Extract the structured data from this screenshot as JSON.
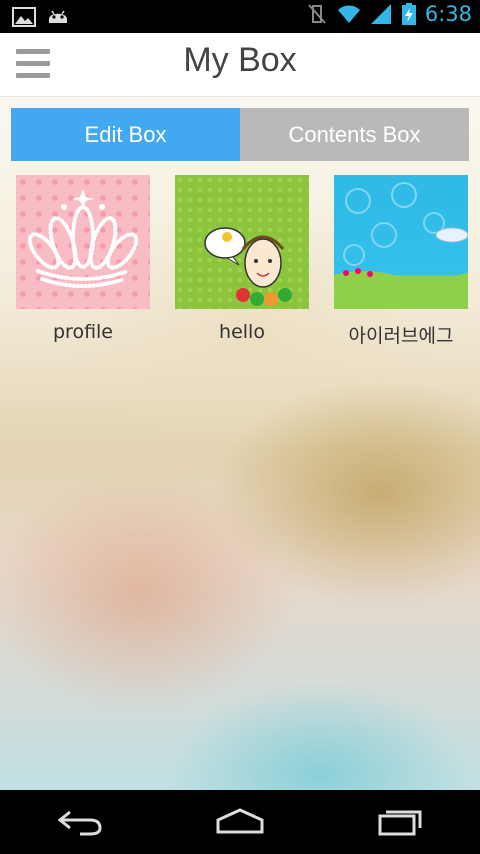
{
  "status_bar": {
    "time": "6:38",
    "left_icons": [
      "image-icon",
      "android-icon"
    ],
    "right_icons": [
      "vibrate-icon",
      "wifi-icon",
      "signal-icon",
      "battery-charging-icon"
    ],
    "accent_color": "#33b5e5"
  },
  "header": {
    "title": "My Box",
    "menu_icon": "hamburger-menu-icon"
  },
  "tabs": [
    {
      "label": "Edit Box",
      "active": true,
      "color": "#42a8f1"
    },
    {
      "label": "Contents Box",
      "active": false,
      "color": "#b9b9b9"
    }
  ],
  "items": [
    {
      "label": "profile",
      "thumbnail": "crown-pink-hearts"
    },
    {
      "label": "hello",
      "thumbnail": "girl-love-green"
    },
    {
      "label": "아이러브에그",
      "thumbnail": "sky-blue-grass"
    }
  ],
  "navigation": {
    "back_icon": "back-icon",
    "home_icon": "home-icon",
    "recents_icon": "recent-apps-icon"
  }
}
